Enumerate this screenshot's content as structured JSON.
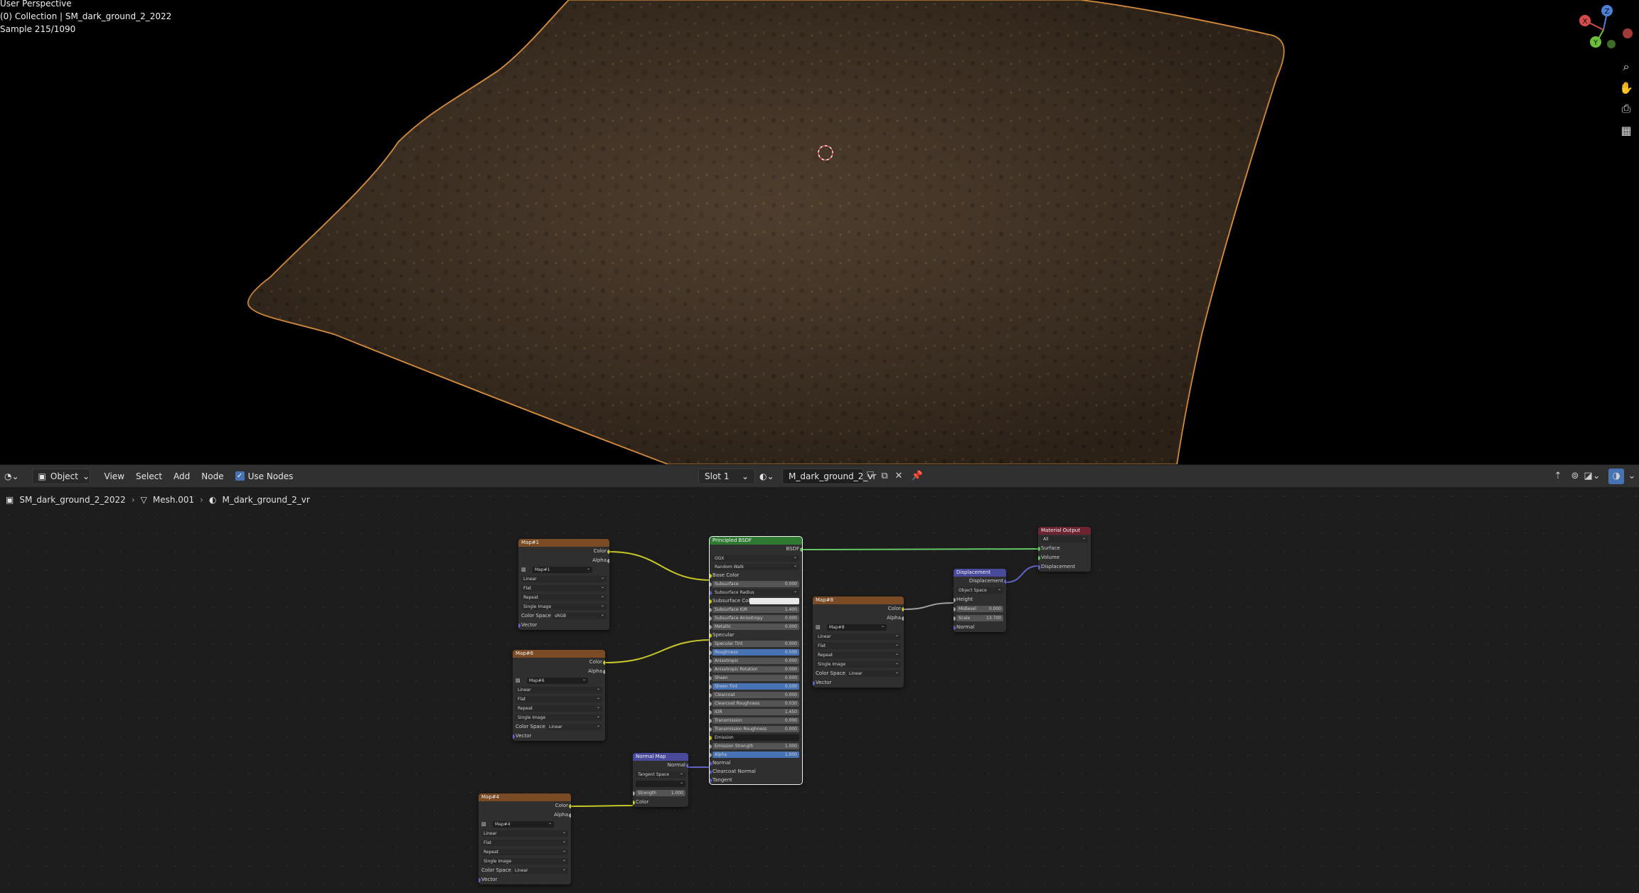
{
  "viewport": {
    "line1": "User Perspective",
    "line2": "(0) Collection | SM_dark_ground_2_2022",
    "line3": "Sample 215/1090",
    "gizmo": {
      "x": "X",
      "y": "Y",
      "z": "Z"
    },
    "nav_icons": [
      "zoom-icon",
      "hand-pan-icon",
      "camera-icon",
      "grid-icon"
    ]
  },
  "header": {
    "mode": "Object",
    "menu": [
      "View",
      "Select",
      "Add",
      "Node"
    ],
    "use_nodes_label": "Use Nodes",
    "use_nodes_checked": true,
    "slot": "Slot 1",
    "material": "M_dark_ground_2_vr"
  },
  "breadcrumb": {
    "object": "SM_dark_ground_2_2022",
    "mesh": "Mesh.001",
    "material": "M_dark_ground_2_vr"
  },
  "nodes": {
    "map1": {
      "title": "Map#1",
      "image": "Map#1",
      "out_color": "Color",
      "out_alpha": "Alpha",
      "interp": "Linear",
      "proj": "Flat",
      "ext": "Repeat",
      "src": "Single Image",
      "cs_label": "Color Space",
      "cs": "sRGB",
      "vector": "Vector"
    },
    "map6": {
      "title": "Map#6",
      "image": "Map#6",
      "out_color": "Color",
      "out_alpha": "Alpha",
      "interp": "Linear",
      "proj": "Flat",
      "ext": "Repeat",
      "src": "Single Image",
      "cs_label": "Color Space",
      "cs": "Linear",
      "vector": "Vector"
    },
    "map4": {
      "title": "Map#4",
      "image": "Map#4",
      "out_color": "Color",
      "out_alpha": "Alpha",
      "interp": "Linear",
      "proj": "Flat",
      "ext": "Repeat",
      "src": "Single Image",
      "cs_label": "Color Space",
      "cs": "Linear",
      "vector": "Vector"
    },
    "map8": {
      "title": "Map#8",
      "image": "Map#8",
      "out_color": "Color",
      "out_alpha": "Alpha",
      "interp": "Linear",
      "proj": "Flat",
      "ext": "Repeat",
      "src": "Single Image",
      "cs_label": "Color Space",
      "cs": "Linear",
      "vector": "Vector"
    },
    "normalmap": {
      "title": "Normal Map",
      "out": "Normal",
      "space": "Tangent Space",
      "strength_label": "Strength",
      "strength": "1.000",
      "color": "Color"
    },
    "bsdf": {
      "title": "Principled BSDF",
      "out": "BSDF",
      "dist": "GGX",
      "sss": "Random Walk",
      "rows": [
        {
          "label": "Base Color",
          "type": "socket"
        },
        {
          "label": "Subsurface",
          "value": "0.000",
          "type": "field"
        },
        {
          "label": "Subsurface Radius",
          "type": "dd"
        },
        {
          "label": "Subsurface Color",
          "type": "color"
        },
        {
          "label": "Subsurface IOR",
          "value": "1.400",
          "type": "field"
        },
        {
          "label": "Subsurface Anisotropy",
          "value": "0.000",
          "type": "field"
        },
        {
          "label": "Metallic",
          "value": "0.000",
          "type": "field"
        },
        {
          "label": "Specular",
          "type": "socket"
        },
        {
          "label": "Specular Tint",
          "value": "0.000",
          "type": "field"
        },
        {
          "label": "Roughness",
          "value": "0.500",
          "type": "sel"
        },
        {
          "label": "Anisotropic",
          "value": "0.000",
          "type": "field"
        },
        {
          "label": "Anisotropic Rotation",
          "value": "0.000",
          "type": "field"
        },
        {
          "label": "Sheen",
          "value": "0.000",
          "type": "field"
        },
        {
          "label": "Sheen Tint",
          "value": "0.500",
          "type": "sel"
        },
        {
          "label": "Clearcoat",
          "value": "0.000",
          "type": "field"
        },
        {
          "label": "Clearcoat Roughness",
          "value": "0.030",
          "type": "field"
        },
        {
          "label": "IOR",
          "value": "1.450",
          "type": "field"
        },
        {
          "label": "Transmission",
          "value": "0.000",
          "type": "field"
        },
        {
          "label": "Transmission Roughness",
          "value": "0.000",
          "type": "field"
        },
        {
          "label": "Emission",
          "type": "dark"
        },
        {
          "label": "Emission Strength",
          "value": "1.000",
          "type": "field"
        },
        {
          "label": "Alpha",
          "value": "1.000",
          "type": "sel"
        },
        {
          "label": "Normal",
          "type": "socket"
        },
        {
          "label": "Clearcoat Normal",
          "type": "socket"
        },
        {
          "label": "Tangent",
          "type": "socket"
        }
      ]
    },
    "displacement": {
      "title": "Displacement",
      "out": "Displacement",
      "space": "Object Space",
      "height": "Height",
      "midlevel_label": "Midlevel",
      "midlevel": "0.000",
      "scale_label": "Scale",
      "scale": "13.700",
      "normal": "Normal"
    },
    "output": {
      "title": "Material Output",
      "target": "All",
      "surface": "Surface",
      "volume": "Volume",
      "displacement": "Displacement"
    }
  },
  "colors": {
    "texture_header": "#7a4b24",
    "shader_header": "#2f7a33",
    "vector_header": "#4a4a9c",
    "output_header": "#6b2430",
    "selection_outline": "#f5a045",
    "accent": "#4772b3"
  }
}
